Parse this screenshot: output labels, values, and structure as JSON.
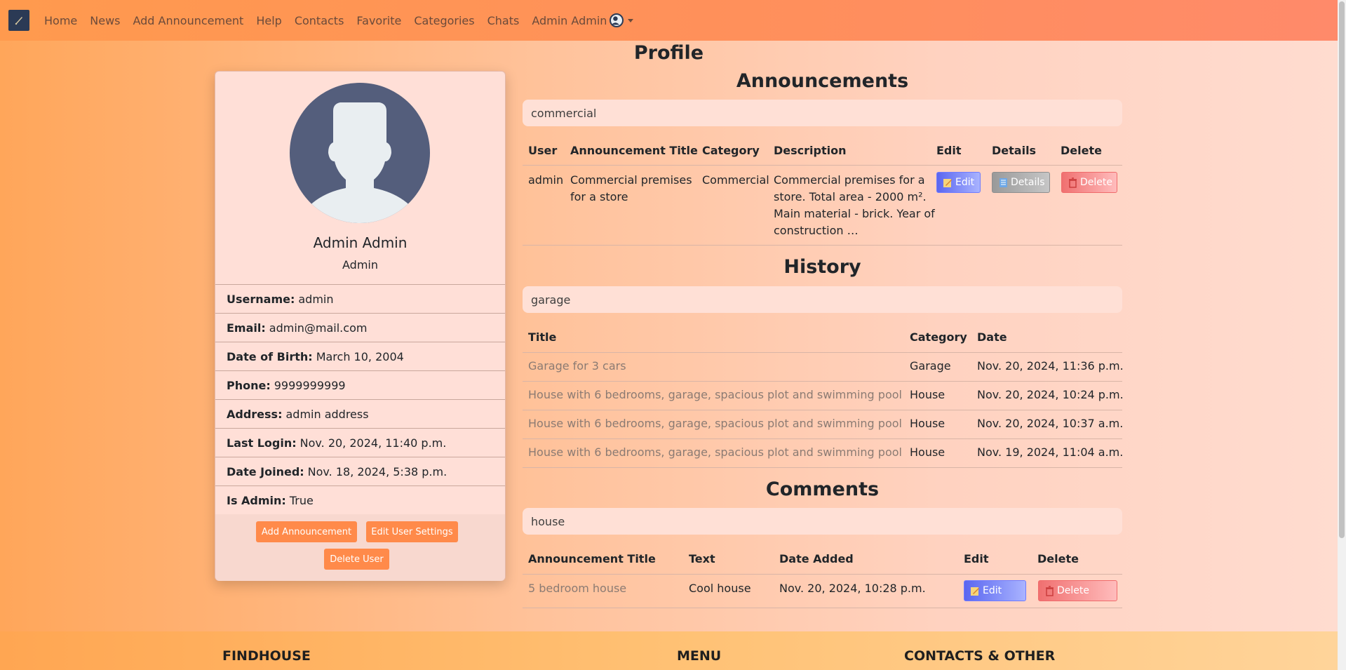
{
  "nav": {
    "links": [
      "Home",
      "News",
      "Add Announcement",
      "Help",
      "Contacts",
      "Favorite",
      "Categories",
      "Chats"
    ],
    "user_label": "Admin Admin"
  },
  "page_title": "Profile",
  "profile": {
    "name": "Admin Admin",
    "role": "Admin",
    "fields": [
      {
        "label": "Username:",
        "value": "admin"
      },
      {
        "label": "Email:",
        "value": "admin@mail.com"
      },
      {
        "label": "Date of Birth:",
        "value": "March 10, 2004"
      },
      {
        "label": "Phone:",
        "value": "9999999999"
      },
      {
        "label": "Address:",
        "value": "admin address"
      },
      {
        "label": "Last Login:",
        "value": "Nov. 20, 2024, 11:40 p.m."
      },
      {
        "label": "Date Joined:",
        "value": "Nov. 18, 2024, 5:38 p.m."
      },
      {
        "label": "Is Admin:",
        "value": "True"
      }
    ],
    "buttons": {
      "add_announcement": "Add Announcement",
      "edit_settings": "Edit User Settings",
      "delete_user": "Delete User"
    }
  },
  "announcements": {
    "title": "Announcements",
    "search_value": "commercial",
    "headers": [
      "User",
      "Announcement Title",
      "Category",
      "Description",
      "Edit",
      "Details",
      "Delete"
    ],
    "row": {
      "user": "admin",
      "title_l1": "Commercial premises",
      "title_l2": "for a store",
      "category": "Commercial",
      "desc_l1": "Commercial premises for a",
      "desc_l2": "store. Total area - 2000 m².",
      "desc_l3": "Main material - brick. Year of",
      "desc_l4": "construction …",
      "edit": "Edit",
      "details": "Details",
      "delete": "Delete"
    }
  },
  "history": {
    "title": "History",
    "search_value": "garage",
    "headers": [
      "Title",
      "Category",
      "Date"
    ],
    "rows": [
      {
        "title": "Garage for 3 cars",
        "category": "Garage",
        "date": "Nov. 20, 2024, 11:36 p.m."
      },
      {
        "title": "House with 6 bedrooms, garage, spacious plot and swimming pool",
        "category": "House",
        "date": "Nov. 20, 2024, 10:24 p.m."
      },
      {
        "title": "House with 6 bedrooms, garage, spacious plot and swimming pool",
        "category": "House",
        "date": "Nov. 20, 2024, 10:37 a.m."
      },
      {
        "title": "House with 6 bedrooms, garage, spacious plot and swimming pool",
        "category": "House",
        "date": "Nov. 19, 2024, 11:04 a.m."
      }
    ]
  },
  "comments": {
    "title": "Comments",
    "search_value": "house",
    "headers": [
      "Announcement Title",
      "Text",
      "Date Added",
      "Edit",
      "Delete"
    ],
    "row": {
      "title": "5 bedroom house",
      "text": "Cool house",
      "date": "Nov. 20, 2024, 10:28 p.m.",
      "edit": "Edit",
      "delete": "Delete"
    }
  },
  "footer": {
    "col1": "FINDHOUSE",
    "col2": "MENU",
    "col3": "CONTACTS & OTHER"
  }
}
